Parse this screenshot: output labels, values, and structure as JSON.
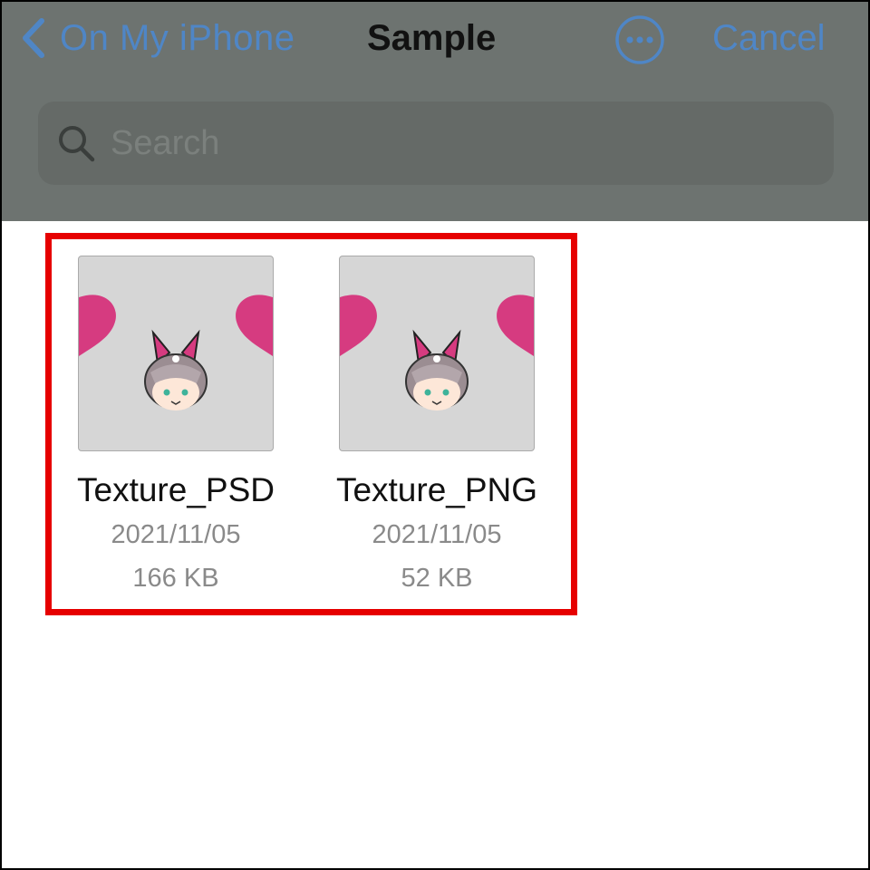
{
  "nav": {
    "back_label": "On My iPhone",
    "title": "Sample",
    "more_icon": "ellipsis-circle-icon",
    "cancel_label": "Cancel"
  },
  "search": {
    "placeholder": "Search",
    "icon": "search-icon"
  },
  "files": [
    {
      "name": "Texture_PSD",
      "date": "2021/11/05",
      "size": "166 KB"
    },
    {
      "name": "Texture_PNG",
      "date": "2021/11/05",
      "size": "52 KB"
    }
  ],
  "colors": {
    "accent": "#4f86c6",
    "header_overlay": "#6d7370",
    "highlight_border": "#e60000",
    "thumb_background": "#d6d6d6",
    "thumb_pink": "#d63b80"
  }
}
